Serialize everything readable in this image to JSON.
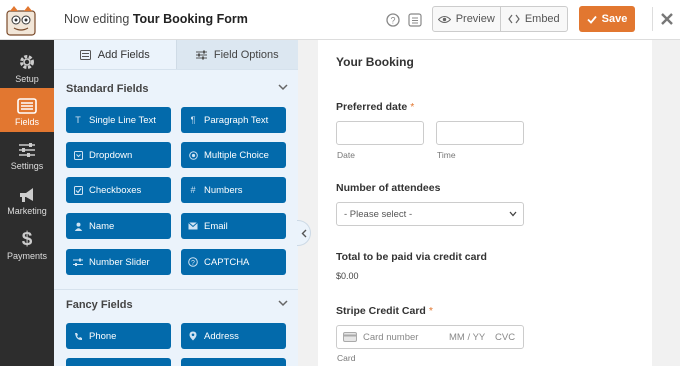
{
  "header": {
    "title_prefix": "Now editing",
    "form_name": "Tour Booking Form",
    "preview_label": "Preview",
    "embed_label": "Embed",
    "save_label": "Save"
  },
  "leftnav": {
    "items": [
      {
        "label": "Setup",
        "icon": "gear-icon"
      },
      {
        "label": "Fields",
        "icon": "fields-icon"
      },
      {
        "label": "Settings",
        "icon": "sliders-icon"
      },
      {
        "label": "Marketing",
        "icon": "megaphone-icon"
      },
      {
        "label": "Payments",
        "icon": "dollar-icon"
      }
    ]
  },
  "panel": {
    "tabs": [
      {
        "label": "Add Fields"
      },
      {
        "label": "Field Options"
      }
    ],
    "standard_title": "Standard Fields",
    "standard_fields": [
      {
        "label": "Single Line Text",
        "icon": "text-icon"
      },
      {
        "label": "Paragraph Text",
        "icon": "paragraph-icon"
      },
      {
        "label": "Dropdown",
        "icon": "dropdown-icon"
      },
      {
        "label": "Multiple Choice",
        "icon": "radio-icon"
      },
      {
        "label": "Checkboxes",
        "icon": "checkbox-icon"
      },
      {
        "label": "Numbers",
        "icon": "hash-icon"
      },
      {
        "label": "Name",
        "icon": "user-icon"
      },
      {
        "label": "Email",
        "icon": "envelope-icon"
      },
      {
        "label": "Number Slider",
        "icon": "slider-icon"
      },
      {
        "label": "CAPTCHA",
        "icon": "question-icon"
      }
    ],
    "fancy_title": "Fancy Fields",
    "fancy_fields": [
      {
        "label": "Phone",
        "icon": "phone-icon"
      },
      {
        "label": "Address",
        "icon": "map-marker-icon"
      },
      {
        "label": "",
        "icon": ""
      },
      {
        "label": "",
        "icon": ""
      }
    ]
  },
  "form": {
    "title": "Your Booking",
    "preferred_date_label": "Preferred date",
    "required_mark": "*",
    "date_sublabel": "Date",
    "time_sublabel": "Time",
    "attendees_label": "Number of attendees",
    "attendees_placeholder": "- Please select -",
    "total_label": "Total to be paid via credit card",
    "total_value": "$0.00",
    "stripe_label": "Stripe Credit Card",
    "card_number_placeholder": "Card number",
    "mmyy_placeholder": "MM / YY",
    "cvc_placeholder": "CVC",
    "card_sublabel": "Card"
  },
  "colors": {
    "accent": "#e27730",
    "field_button": "#036aab",
    "nav_bg": "#2d2d2d",
    "panel_bg": "#ebf3fb"
  }
}
